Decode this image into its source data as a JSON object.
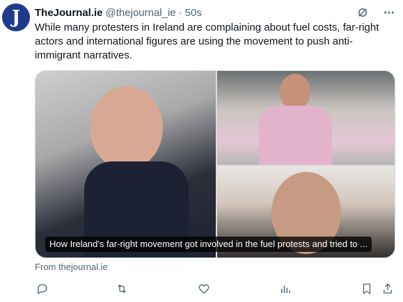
{
  "author": {
    "avatar_letter": "J",
    "name": "TheJournal.ie",
    "handle": "@thejournal_ie",
    "separator": "·",
    "time": "50s"
  },
  "tweet_text": "While many protesters in Ireland are complaining about fuel costs, far-right actors and international figures are using the movement to push anti-immigrant narratives.",
  "card": {
    "caption": "How Ireland's far-right movement got involved in the fuel protests and tried to ...",
    "source": "From thejournal.ie"
  },
  "icons": {
    "header": [
      "grok-icon",
      "more-icon"
    ],
    "actions": [
      "reply-icon",
      "repost-icon",
      "like-icon",
      "views-icon",
      "bookmark-icon",
      "share-icon"
    ]
  },
  "colors": {
    "avatar_bg": "#1e3a8a",
    "text": "#0f1419",
    "muted": "#536471"
  }
}
